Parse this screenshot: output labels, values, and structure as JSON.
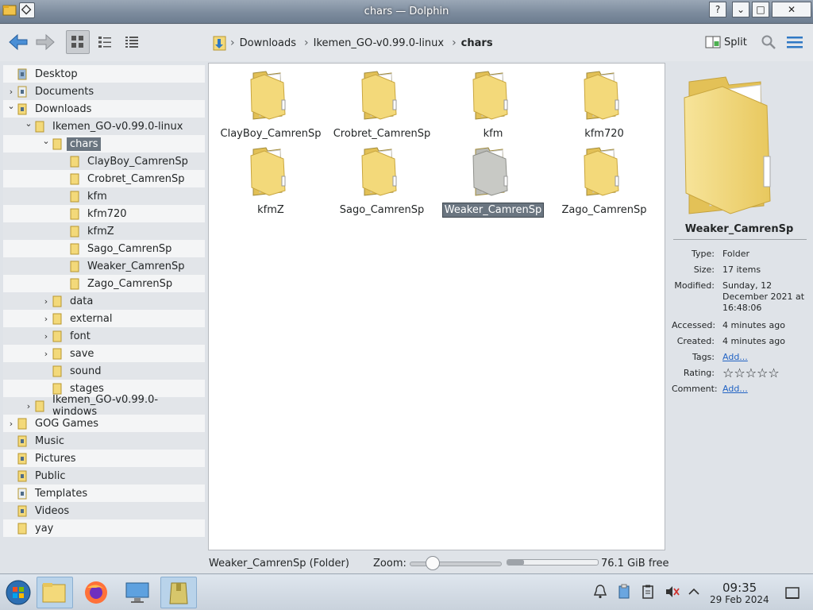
{
  "window": {
    "title": "chars — Dolphin",
    "help": "?",
    "minimize": "⌄",
    "maximize": "□",
    "close": "✕"
  },
  "toolbar": {
    "breadcrumb": [
      "Downloads",
      "Ikemen_GO-v0.99.0-linux",
      "chars"
    ],
    "split_label": "Split"
  },
  "tree": [
    {
      "label": "Desktop",
      "depth": 0,
      "expander": "",
      "icon": "desktop-icon"
    },
    {
      "label": "Documents",
      "depth": 0,
      "expander": ">",
      "icon": "documents-icon"
    },
    {
      "label": "Downloads",
      "depth": 0,
      "expander": "v",
      "icon": "downloads-icon"
    },
    {
      "label": "Ikemen_GO-v0.99.0-linux",
      "depth": 1,
      "expander": "v",
      "icon": "folder-icon"
    },
    {
      "label": "chars",
      "depth": 2,
      "expander": "v",
      "icon": "folder-icon",
      "selected": true
    },
    {
      "label": "ClayBoy_CamrenSp",
      "depth": 3,
      "expander": "",
      "icon": "folder-icon"
    },
    {
      "label": "Crobret_CamrenSp",
      "depth": 3,
      "expander": "",
      "icon": "folder-icon"
    },
    {
      "label": "kfm",
      "depth": 3,
      "expander": "",
      "icon": "folder-icon"
    },
    {
      "label": "kfm720",
      "depth": 3,
      "expander": "",
      "icon": "folder-icon"
    },
    {
      "label": "kfmZ",
      "depth": 3,
      "expander": "",
      "icon": "folder-icon"
    },
    {
      "label": "Sago_CamrenSp",
      "depth": 3,
      "expander": "",
      "icon": "folder-icon"
    },
    {
      "label": "Weaker_CamrenSp",
      "depth": 3,
      "expander": "",
      "icon": "folder-icon"
    },
    {
      "label": "Zago_CamrenSp",
      "depth": 3,
      "expander": "",
      "icon": "folder-icon"
    },
    {
      "label": "data",
      "depth": 2,
      "expander": ">",
      "icon": "folder-icon"
    },
    {
      "label": "external",
      "depth": 2,
      "expander": ">",
      "icon": "folder-icon"
    },
    {
      "label": "font",
      "depth": 2,
      "expander": ">",
      "icon": "folder-icon"
    },
    {
      "label": "save",
      "depth": 2,
      "expander": ">",
      "icon": "folder-icon"
    },
    {
      "label": "sound",
      "depth": 2,
      "expander": "",
      "icon": "folder-icon"
    },
    {
      "label": "stages",
      "depth": 2,
      "expander": "",
      "icon": "folder-icon"
    },
    {
      "label": "Ikemen_GO-v0.99.0-windows",
      "depth": 1,
      "expander": ">",
      "icon": "folder-icon"
    },
    {
      "label": "GOG Games",
      "depth": 0,
      "expander": ">",
      "icon": "folder-icon"
    },
    {
      "label": "Music",
      "depth": 0,
      "expander": "",
      "icon": "music-icon"
    },
    {
      "label": "Pictures",
      "depth": 0,
      "expander": "",
      "icon": "pictures-icon"
    },
    {
      "label": "Public",
      "depth": 0,
      "expander": "",
      "icon": "public-icon"
    },
    {
      "label": "Templates",
      "depth": 0,
      "expander": "",
      "icon": "templates-icon"
    },
    {
      "label": "Videos",
      "depth": 0,
      "expander": "",
      "icon": "videos-icon"
    },
    {
      "label": "yay",
      "depth": 0,
      "expander": "",
      "icon": "folder-icon"
    }
  ],
  "items": [
    {
      "name": "ClayBoy_CamrenSp"
    },
    {
      "name": "Crobret_CamrenSp"
    },
    {
      "name": "kfm"
    },
    {
      "name": "kfm720"
    },
    {
      "name": "kfmZ"
    },
    {
      "name": "Sago_CamrenSp"
    },
    {
      "name": "Weaker_CamrenSp",
      "selected": true
    },
    {
      "name": "Zago_CamrenSp"
    }
  ],
  "info": {
    "name": "Weaker_CamrenSp",
    "fields": [
      {
        "key": "Type:",
        "value": "Folder"
      },
      {
        "key": "Size:",
        "value": "17 items"
      },
      {
        "key": "Modified:",
        "value": "Sunday, 12 December 2021 at 16:48:06"
      },
      {
        "key": "Accessed:",
        "value": "4 minutes ago"
      },
      {
        "key": "Created:",
        "value": "4 minutes ago"
      },
      {
        "key": "Tags:",
        "value": "Add...",
        "link": true
      },
      {
        "key": "Rating:",
        "value": "☆☆☆☆☆",
        "stars": true
      },
      {
        "key": "Comment:",
        "value": "Add...",
        "link": true
      }
    ],
    "rating": 0
  },
  "status": {
    "text": "Weaker_CamrenSp (Folder)",
    "zoom_label": "Zoom:",
    "zoom_level": 0.2,
    "free_space": "76.1 GiB free",
    "used_fraction": 0.18
  },
  "clock": {
    "time": "09:35",
    "date": "29 Feb 2024"
  },
  "colors": {
    "selection": "#6a7580",
    "folder": "#f3d97a",
    "folder_selected": "#c8c9c5",
    "accent": "#2f78c4"
  }
}
